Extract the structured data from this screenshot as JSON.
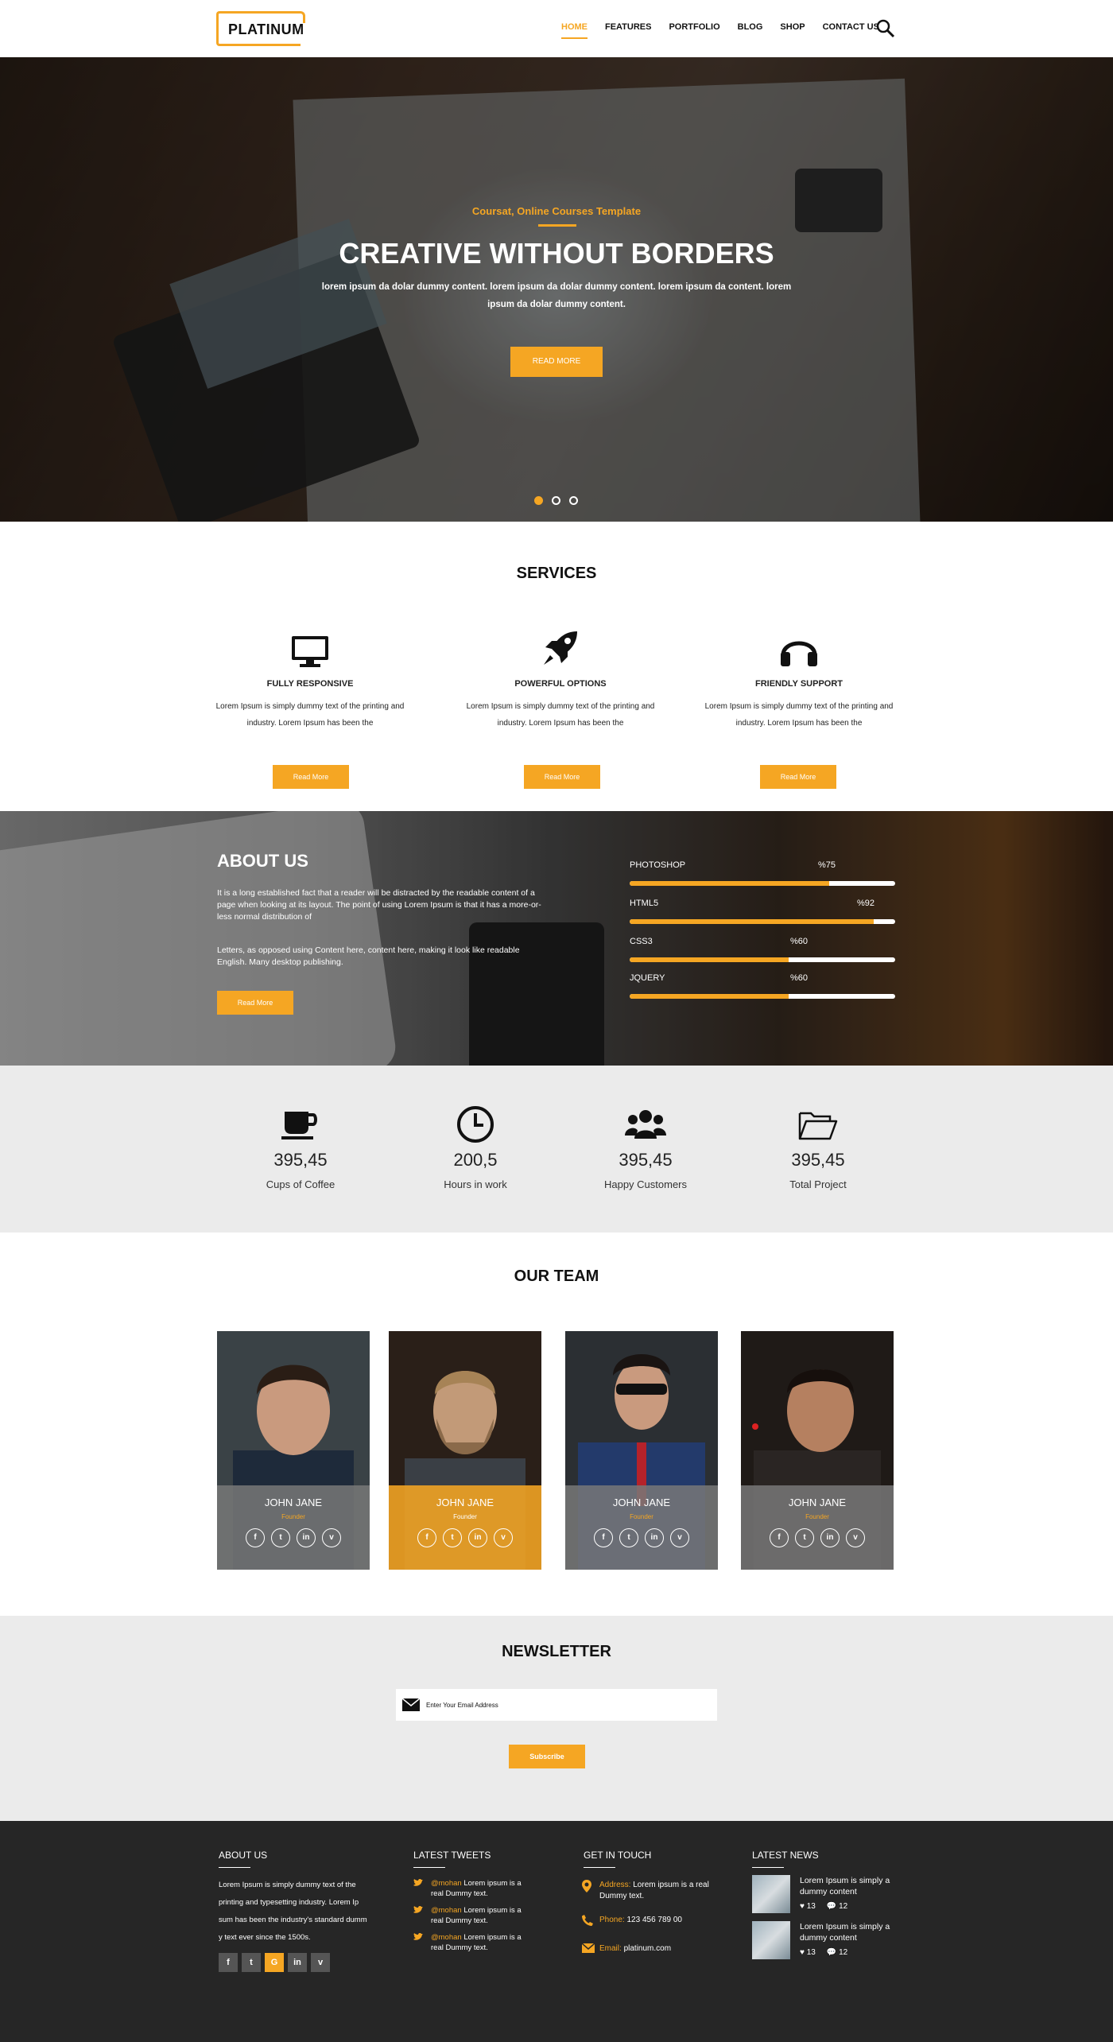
{
  "header": {
    "logo": "PLATINUM",
    "nav": [
      "HOME",
      "FEATURES",
      "PORTFOLIO",
      "BLOG",
      "SHOP",
      "CONTACT US"
    ],
    "active_nav": "HOME",
    "search_icon": "search-icon"
  },
  "hero": {
    "subtitle": "Coursat, Online Courses Template",
    "title": "CREATIVE WITHOUT BORDERS",
    "text": "lorem ipsum da dolar dummy content. lorem ipsum da dolar dummy content. lorem ipsum da content. lorem ipsum da dolar dummy content.",
    "button": "READ MORE",
    "slides": 3,
    "active_slide": 1
  },
  "services": {
    "title": "SERVICES",
    "items": [
      {
        "icon": "monitor-icon",
        "title": "FULLY RESPONSIVE",
        "text": "Lorem Ipsum is simply dummy text of the printing and industry. Lorem Ipsum has been the",
        "button": "Read More"
      },
      {
        "icon": "rocket-icon",
        "title": "POWERFUL OPTIONS",
        "text": "Lorem Ipsum is simply dummy text of the printing and industry. Lorem Ipsum has been the",
        "button": "Read More"
      },
      {
        "icon": "headphones-icon",
        "title": "FRIENDLY SUPPORT",
        "text": "Lorem Ipsum is simply dummy text of the printing and industry. Lorem Ipsum has been the",
        "button": "Read More"
      }
    ]
  },
  "about": {
    "title": "ABOUT US",
    "p1": "It is a long established fact that a reader will be distracted by the readable  content of a page when looking at its layout. The point of using Lorem Ipsum is that it has a more-or-less normal distribution of",
    "p2": "Letters, as opposed using Content here, content here, making it look like readable English. Many desktop publishing.",
    "button": "Read More",
    "skills": [
      {
        "name": "PHOTOSHOP",
        "label": "%75",
        "value": 75
      },
      {
        "name": "HTML5",
        "label": "%92",
        "value": 92
      },
      {
        "name": "CSS3",
        "label": "%60",
        "value": 60
      },
      {
        "name": "JQUERY",
        "label": "%60",
        "value": 60
      }
    ]
  },
  "stats": [
    {
      "icon": "coffee-cup-icon",
      "value": "395,45",
      "label": "Cups of Coffee"
    },
    {
      "icon": "clock-icon",
      "value": "200,5",
      "label": "Hours in work"
    },
    {
      "icon": "users-icon",
      "value": "395,45",
      "label": "Happy Customers"
    },
    {
      "icon": "folder-icon",
      "value": "395,45",
      "label": "Total Project"
    }
  ],
  "team": {
    "title": "OUR TEAM",
    "members": [
      {
        "name": "JOHN JANE",
        "role": "Founder",
        "highlight": false
      },
      {
        "name": "JOHN JANE",
        "role": "Founder",
        "highlight": true
      },
      {
        "name": "JOHN JANE",
        "role": "Founder",
        "highlight": false
      },
      {
        "name": "JOHN JANE",
        "role": "Founder",
        "highlight": false
      }
    ],
    "social": [
      "facebook-icon",
      "twitter-icon",
      "linkedin-icon",
      "vimeo-icon"
    ]
  },
  "newsletter": {
    "title": "NEWSLETTER",
    "placeholder": "Enter Your Email Address",
    "button": "Subscribe"
  },
  "footer": {
    "about": {
      "title": "ABOUT US",
      "lines": [
        "Lorem Ipsum is simply dummy text of the",
        "printing and typesetting industry. Lorem Ip",
        "sum has been the industry's standard dumm",
        "y text ever since the 1500s."
      ]
    },
    "tweets": {
      "title": "LATEST TWEETS",
      "items": [
        {
          "handle": "@mohan",
          "text": " Lorem ipsum is a real Dummy text."
        },
        {
          "handle": "@mohan",
          "text": " Lorem ipsum is a real Dummy text."
        },
        {
          "handle": "@mohan",
          "text": " Lorem ipsum is a real Dummy text."
        }
      ]
    },
    "contact": {
      "title": "GET IN TOUCH",
      "address_key": "Address:",
      "address": " Lorem ipsum is a real Dummy text.",
      "phone_key": "Phone:",
      "phone": " 123 456 789 00",
      "email_key": "Email:",
      "email": " platinum.com"
    },
    "news": {
      "title": "LATEST NEWS",
      "items": [
        {
          "text": "Lorem Ipsum is simply a dummy  content",
          "likes": "13",
          "comments": "12"
        },
        {
          "text": "Lorem Ipsum is simply a dummy  content",
          "likes": "13",
          "comments": "12"
        }
      ]
    }
  },
  "colors": {
    "accent": "#f5a623",
    "footer_bg": "#262626",
    "light_bg": "#ebebeb"
  }
}
